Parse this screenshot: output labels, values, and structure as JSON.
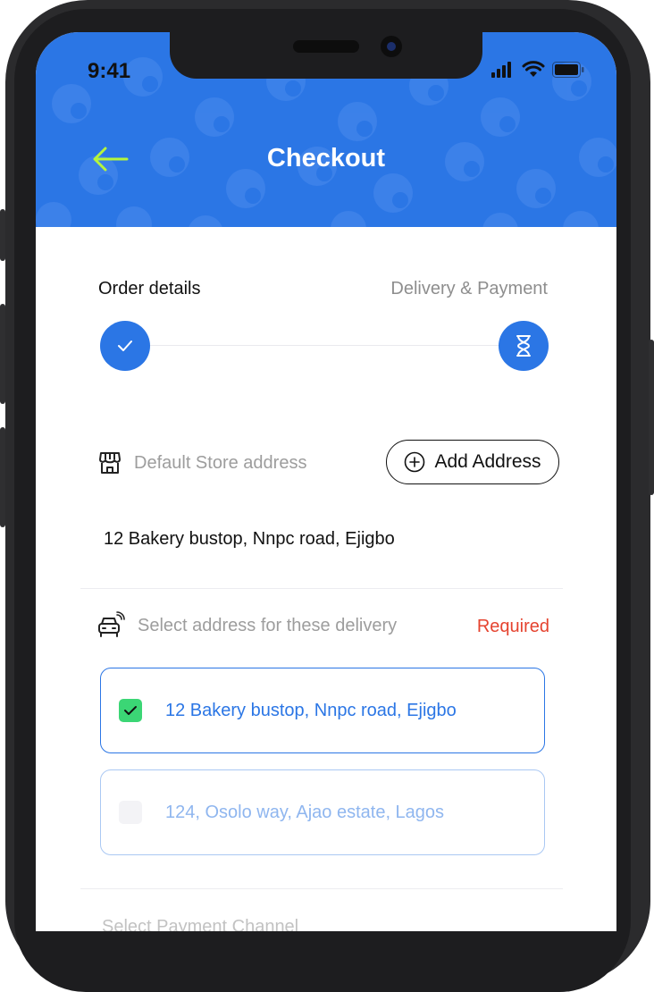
{
  "status_bar": {
    "time": "9:41"
  },
  "header": {
    "title": "Checkout"
  },
  "steps": [
    {
      "label": "Order details",
      "state": "completed"
    },
    {
      "label": "Delivery & Payment",
      "state": "pending"
    }
  ],
  "store": {
    "label": "Default Store address",
    "add_button_label": "Add Address",
    "address": "12 Bakery bustop, Nnpc road, Ejigbo"
  },
  "delivery": {
    "label": "Select address for these delivery",
    "required_label": "Required",
    "options": [
      {
        "text": "12 Bakery bustop, Nnpc road, Ejigbo",
        "checked": true
      },
      {
        "text": "124, Osolo way, Ajao estate, Lagos",
        "checked": false
      }
    ]
  },
  "payment": {
    "label": "Select Payment Channel"
  },
  "colors": {
    "primary": "#2b76e5",
    "back_arrow": "#b5f53c",
    "required": "#e5432f",
    "checkbox_on": "#3bd675"
  },
  "icons": {
    "back": "arrow-left-icon",
    "step_done": "checkmark-icon",
    "step_pending": "hourglass-icon",
    "store": "store-icon",
    "add": "plus-circle-icon",
    "delivery": "delivery-car-icon"
  }
}
